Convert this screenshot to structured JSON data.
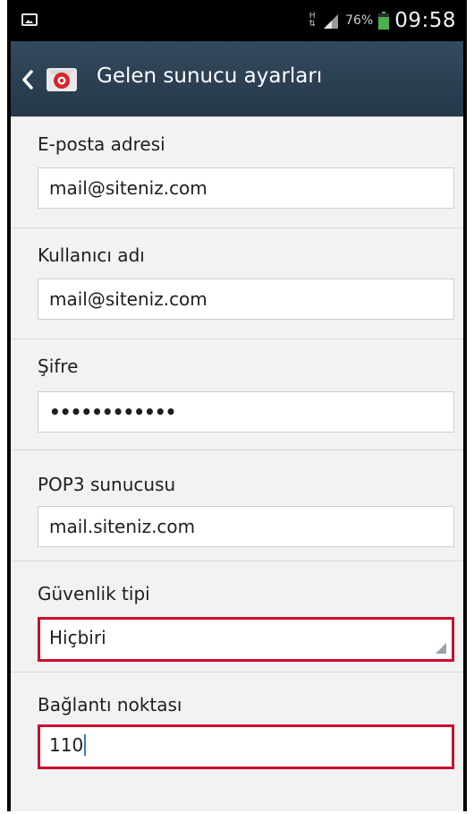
{
  "status_bar": {
    "network_type_icon": "H",
    "signal_icon": "signal-bars-icon",
    "battery_percent": "76%",
    "battery_icon": "battery-icon",
    "time": "09:58",
    "notification_icon": "image-notification-icon"
  },
  "action_bar": {
    "back_icon": "chevron-left-icon",
    "app_icon": "email-app-icon",
    "title": "Gelen sunucu ayarları"
  },
  "form": {
    "email": {
      "label": "E-posta adresi",
      "value": "mail@siteniz.com"
    },
    "username": {
      "label": "Kullanıcı adı",
      "value": "mail@siteniz.com"
    },
    "password": {
      "label": "Şifre",
      "value": "••••••••••••"
    },
    "pop3_server": {
      "label": "POP3 sunucusu",
      "value": "mail.siteniz.com"
    },
    "security_type": {
      "label": "Güvenlik tipi",
      "value": "Hiçbiri"
    },
    "port": {
      "label": "Bağlantı noktası",
      "value": "110"
    }
  },
  "colors": {
    "action_bar": "#2c3e50",
    "highlight_border": "#c8102e",
    "battery_green": "#4caf50",
    "content_bg": "#f2f2f2"
  }
}
